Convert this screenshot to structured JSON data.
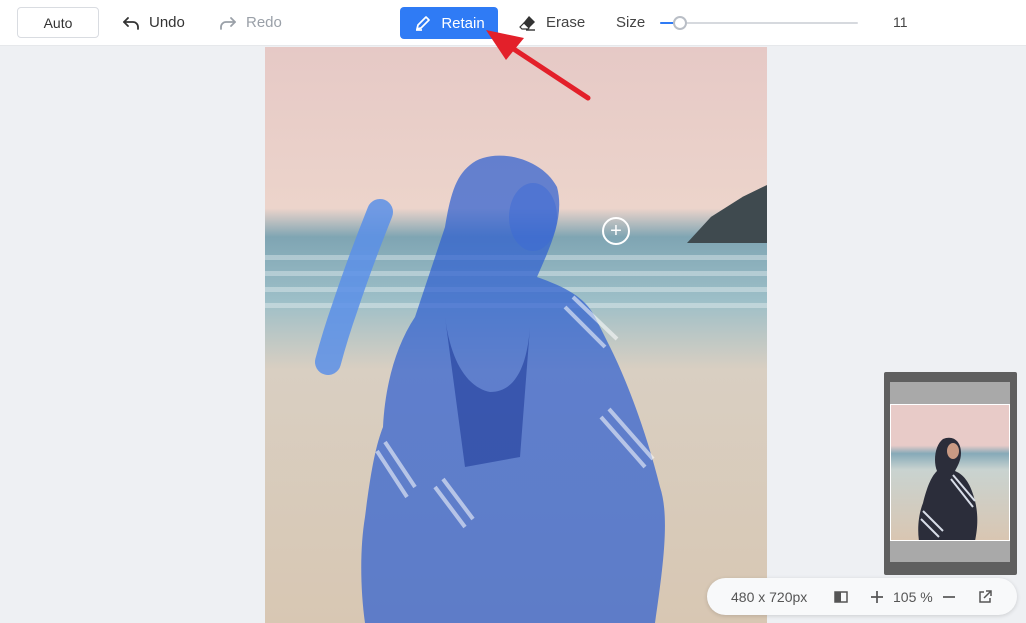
{
  "toolbar": {
    "auto_label": "Auto",
    "undo_label": "Undo",
    "redo_label": "Redo",
    "retain_label": "Retain",
    "erase_label": "Erase",
    "size_label": "Size",
    "size_value": "11",
    "size_slider_fraction": 0.1,
    "accent_color": "#2f7bf5"
  },
  "status": {
    "dimensions": "480 x 720px",
    "zoom": "105 %"
  },
  "icons": {
    "undo": "undo-icon",
    "redo": "redo-icon",
    "retain": "pencil-icon",
    "erase": "eraser-icon",
    "compare": "compare-icon",
    "zoom_in": "plus-icon",
    "zoom_out": "minus-icon",
    "expand": "external-link-icon",
    "cursor": "brush-cursor-icon"
  },
  "colors": {
    "mask": "#2f5fd0",
    "stroke": "#5a8fe8",
    "arrow": "#e3202a"
  }
}
